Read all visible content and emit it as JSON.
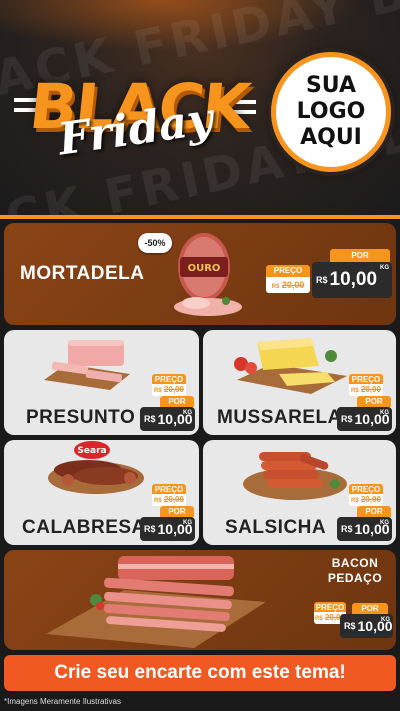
{
  "header": {
    "bg_words_1": "ACK FRIDAY BLA",
    "bg_words_2": "ACK FRIDAY BLACK",
    "title_main": "BLACK",
    "title_script": "Friday",
    "logo_text": "SUA\nLOGO\nAQUI"
  },
  "products": {
    "mortadela": {
      "name": "MORTADELA",
      "discount": "-50%",
      "brand": "OURO",
      "preco_label": "PREÇO",
      "old_prefix": "R$",
      "old_price": "20,00",
      "por_label": "POR",
      "currency": "R$",
      "new_price": "10,00",
      "unit": "KG"
    },
    "presunto": {
      "name": "PRESUNTO",
      "preco_label": "PREÇO",
      "old_prefix": "R$",
      "old_price": "20,00",
      "por_label": "POR",
      "currency": "R$",
      "new_price": "10,00",
      "unit": "KG"
    },
    "mussarela": {
      "name": "MUSSARELA",
      "preco_label": "PREÇO",
      "old_prefix": "R$",
      "old_price": "20,00",
      "por_label": "POR",
      "currency": "R$",
      "new_price": "10,00",
      "unit": "KG"
    },
    "calabresa": {
      "name": "CALABRESA",
      "brand": "Seara",
      "preco_label": "PREÇO",
      "old_prefix": "R$",
      "old_price": "20,00",
      "por_label": "POR",
      "currency": "R$",
      "new_price": "10,00",
      "unit": "KG"
    },
    "salsicha": {
      "name": "SALSICHA",
      "preco_label": "PREÇO",
      "old_prefix": "R$",
      "old_price": "20,00",
      "por_label": "POR",
      "currency": "R$",
      "new_price": "10,00",
      "unit": "KG"
    },
    "bacon": {
      "name_line1": "BACON",
      "name_line2": "PEDAÇO",
      "preco_label": "PREÇO",
      "old_prefix": "R$",
      "old_price": "20,00",
      "por_label": "POR",
      "currency": "R$",
      "new_price": "10,00",
      "unit": "KG"
    }
  },
  "footer": {
    "cta": "Crie seu encarte com este tema!",
    "note": "*Imagens Meramente Ilustrativas"
  },
  "colors": {
    "accent": "#f7941d",
    "brown": "#7a3c12",
    "cta": "#f05a22",
    "dark": "#1b1b1b"
  }
}
